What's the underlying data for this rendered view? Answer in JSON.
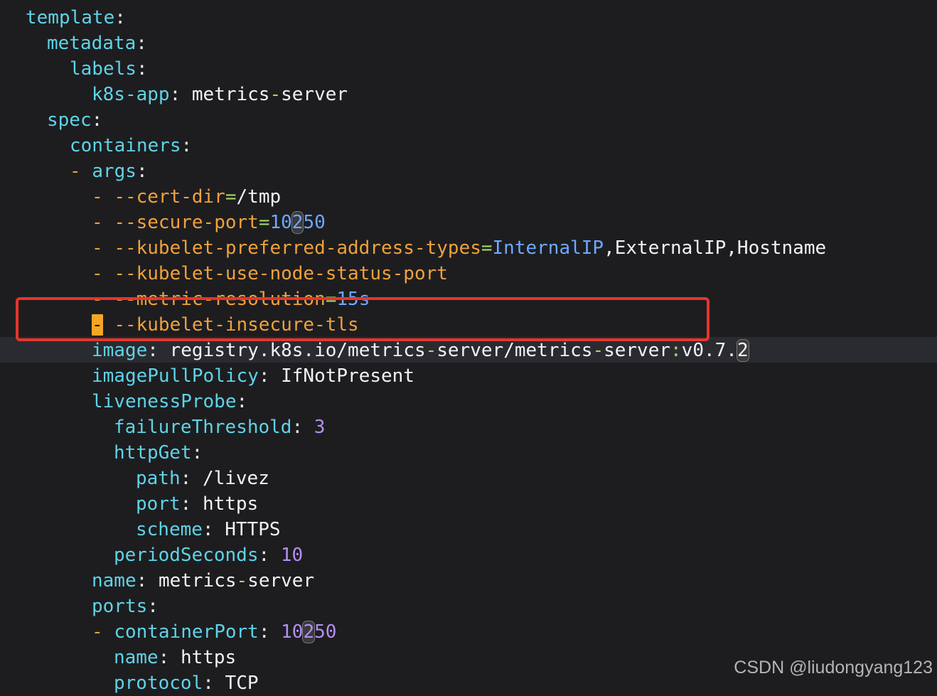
{
  "editor": {
    "lines": [
      {
        "id": "l1",
        "segments": [
          {
            "t": "template",
            "c": "key"
          },
          {
            "t": ":",
            "c": "punct"
          }
        ]
      },
      {
        "id": "l2",
        "segments": [
          {
            "t": "metadata",
            "c": "key"
          },
          {
            "t": ":",
            "c": "punct"
          }
        ]
      },
      {
        "id": "l3",
        "segments": [
          {
            "t": "labels",
            "c": "key"
          },
          {
            "t": ":",
            "c": "punct"
          }
        ]
      },
      {
        "id": "l4",
        "segments": [
          {
            "t": "k8s-app",
            "c": "key"
          },
          {
            "t": ": ",
            "c": "punct"
          },
          {
            "t": "metrics",
            "c": "val"
          },
          {
            "t": "-",
            "c": "eq"
          },
          {
            "t": "server",
            "c": "val"
          }
        ]
      },
      {
        "id": "l5",
        "segments": [
          {
            "t": "spec",
            "c": "key"
          },
          {
            "t": ":",
            "c": "punct"
          }
        ]
      },
      {
        "id": "l6",
        "segments": [
          {
            "t": "containers",
            "c": "key"
          },
          {
            "t": ":",
            "c": "punct"
          }
        ]
      },
      {
        "id": "l7",
        "segments": [
          {
            "t": "- ",
            "c": "dash"
          },
          {
            "t": "args",
            "c": "key"
          },
          {
            "t": ":",
            "c": "punct"
          }
        ]
      },
      {
        "id": "l8",
        "segments": [
          {
            "t": "- ",
            "c": "dash"
          },
          {
            "t": "--cert-dir",
            "c": "arg"
          },
          {
            "t": "=",
            "c": "eq"
          },
          {
            "t": "/tmp",
            "c": "val"
          }
        ]
      },
      {
        "id": "l9",
        "segments": [
          {
            "t": "- ",
            "c": "dash"
          },
          {
            "t": "--secure-port",
            "c": "arg"
          },
          {
            "t": "=",
            "c": "eq"
          },
          {
            "t": "10",
            "c": "enum"
          },
          {
            "t": "2",
            "c": "enum",
            "mark": true
          },
          {
            "t": "50",
            "c": "enum"
          }
        ]
      },
      {
        "id": "l10",
        "segments": [
          {
            "t": "- ",
            "c": "dash"
          },
          {
            "t": "--kubelet-preferred-address-types",
            "c": "arg"
          },
          {
            "t": "=",
            "c": "eq"
          },
          {
            "t": "InternalIP",
            "c": "enum"
          },
          {
            "t": ",ExternalIP,Hostname",
            "c": "val"
          }
        ]
      },
      {
        "id": "l11",
        "segments": [
          {
            "t": "- ",
            "c": "dash"
          },
          {
            "t": "--kubelet-use-node-status-port",
            "c": "arg"
          }
        ]
      },
      {
        "id": "l12",
        "segments": [
          {
            "t": "- ",
            "c": "dash"
          },
          {
            "t": "--metric-resolution",
            "c": "arg"
          },
          {
            "t": "=",
            "c": "eq"
          },
          {
            "t": "15s",
            "c": "enum"
          }
        ]
      },
      {
        "id": "l13",
        "segments": [
          {
            "t": "-",
            "c": "dash",
            "cursor": true
          },
          {
            "t": " ",
            "c": "val"
          },
          {
            "t": "--kubelet-insecure-tls",
            "c": "arg"
          }
        ]
      },
      {
        "id": "l14",
        "segments": [
          {
            "t": "image",
            "c": "key"
          },
          {
            "t": ": ",
            "c": "punct"
          },
          {
            "t": "registry.k8s.io/metrics",
            "c": "val"
          },
          {
            "t": "-",
            "c": "eq"
          },
          {
            "t": "server/metrics",
            "c": "val"
          },
          {
            "t": "-",
            "c": "eq"
          },
          {
            "t": "server",
            "c": "val"
          },
          {
            "t": ":",
            "c": "eq"
          },
          {
            "t": "v0.7.",
            "c": "val"
          },
          {
            "t": "2",
            "c": "val",
            "mark": true
          }
        ]
      },
      {
        "id": "l15",
        "segments": [
          {
            "t": "imagePullPolicy",
            "c": "key"
          },
          {
            "t": ": ",
            "c": "punct"
          },
          {
            "t": "IfNotPresent",
            "c": "val"
          }
        ]
      },
      {
        "id": "l16",
        "segments": [
          {
            "t": "livenessProbe",
            "c": "key"
          },
          {
            "t": ":",
            "c": "punct"
          }
        ]
      },
      {
        "id": "l17",
        "segments": [
          {
            "t": "failureThreshold",
            "c": "key"
          },
          {
            "t": ": ",
            "c": "punct"
          },
          {
            "t": "3",
            "c": "num"
          }
        ]
      },
      {
        "id": "l18",
        "segments": [
          {
            "t": "httpGet",
            "c": "key"
          },
          {
            "t": ":",
            "c": "punct"
          }
        ]
      },
      {
        "id": "l19",
        "segments": [
          {
            "t": "path",
            "c": "key"
          },
          {
            "t": ": ",
            "c": "punct"
          },
          {
            "t": "/livez",
            "c": "val"
          }
        ]
      },
      {
        "id": "l20",
        "segments": [
          {
            "t": "port",
            "c": "key"
          },
          {
            "t": ": ",
            "c": "punct"
          },
          {
            "t": "https",
            "c": "val"
          }
        ]
      },
      {
        "id": "l21",
        "segments": [
          {
            "t": "scheme",
            "c": "key"
          },
          {
            "t": ": ",
            "c": "punct"
          },
          {
            "t": "HTTPS",
            "c": "val"
          }
        ]
      },
      {
        "id": "l22",
        "segments": [
          {
            "t": "periodSeconds",
            "c": "key"
          },
          {
            "t": ": ",
            "c": "punct"
          },
          {
            "t": "10",
            "c": "num"
          }
        ]
      },
      {
        "id": "l23",
        "segments": [
          {
            "t": "name",
            "c": "key"
          },
          {
            "t": ": ",
            "c": "punct"
          },
          {
            "t": "metrics",
            "c": "val"
          },
          {
            "t": "-",
            "c": "eq"
          },
          {
            "t": "server",
            "c": "val"
          }
        ]
      },
      {
        "id": "l24",
        "segments": [
          {
            "t": "ports",
            "c": "key"
          },
          {
            "t": ":",
            "c": "punct"
          }
        ]
      },
      {
        "id": "l25",
        "segments": [
          {
            "t": "- ",
            "c": "dash"
          },
          {
            "t": "containerPort",
            "c": "key"
          },
          {
            "t": ": ",
            "c": "punct"
          },
          {
            "t": "10",
            "c": "num"
          },
          {
            "t": "2",
            "c": "num",
            "mark": true
          },
          {
            "t": "50",
            "c": "num"
          }
        ]
      },
      {
        "id": "l26",
        "segments": [
          {
            "t": "name",
            "c": "key"
          },
          {
            "t": ": ",
            "c": "punct"
          },
          {
            "t": "https",
            "c": "val"
          }
        ]
      },
      {
        "id": "l27",
        "segments": [
          {
            "t": "protocol",
            "c": "key"
          },
          {
            "t": ": ",
            "c": "punct"
          },
          {
            "t": "TCP",
            "c": "val"
          }
        ]
      }
    ]
  },
  "watermark": {
    "text": "CSDN @liudongyang123"
  },
  "colors": {
    "background": "#1d1d20",
    "highlight_box": "#e5352b",
    "cursor": "#f5a623"
  }
}
